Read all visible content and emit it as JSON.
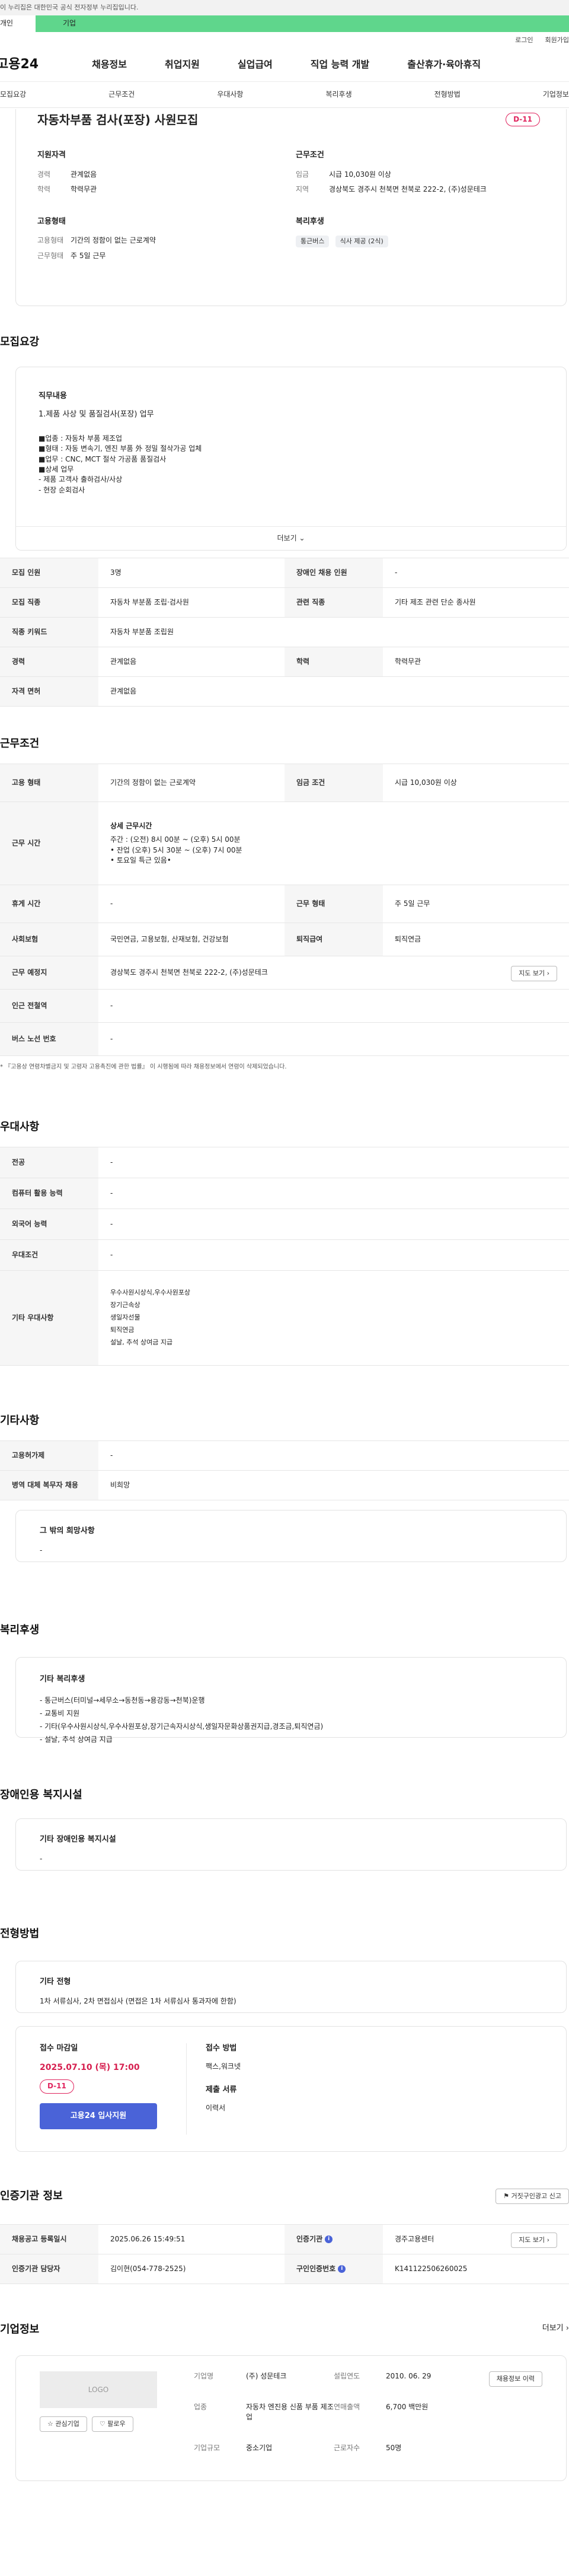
{
  "gov_banner": "이 누리집은 대한민국 공식 전자정부 누리집입니다.",
  "top_tabs": [
    "개인",
    "기업"
  ],
  "util_links": [
    "로그인",
    "회원가입"
  ],
  "logo": "고용24",
  "gnb": [
    "채용정보",
    "취업지원",
    "실업급여",
    "직업 능력 개발",
    "출산휴가·육아휴직"
  ],
  "anchor_tabs": [
    "모집요강",
    "근무조건",
    "우대사항",
    "복리후생",
    "전형방법",
    "기업정보"
  ],
  "job": {
    "title": "자동차부품 검사(포장) 사원모집",
    "dday": "D-11",
    "qualification_title": "지원자격",
    "career_label": "경력",
    "career_value": "관계없음",
    "edu_label": "학력",
    "edu_value": "학력무관",
    "worktype_title": "고용형태",
    "emp_label": "고용형태",
    "emp_value": "기간의 정함이 없는 근로계약",
    "days_label": "근무형태",
    "days_value": "주 5일 근무",
    "cond_title": "근무조건",
    "wage_label": "임금",
    "wage_value": "시급 10,030원 이상",
    "region_label": "지역",
    "region_value": "경상북도 경주시 천북면 천북로 222-2, (주)성문테크",
    "welfare_title": "복리후생",
    "welfare_tags": [
      "통근버스",
      "식사 제공 (2식)"
    ]
  },
  "recruit": {
    "section_title": "모집요강",
    "duty_title": "직무내용",
    "duty_main": "1.제품 사상 및 품질검사(포장) 업무",
    "duty_lines": [
      "■업종 : 자동차 부품 제조업",
      "■형태 : 자동 변속기, 엔진 부품 外 정밀 절삭가공 업체",
      "■업무 : CNC, MCT 절삭 가공품 품질검사",
      "■상세 업무",
      "  - 제품 고객사 출하검사/사상",
      "  - 현장 순회검사"
    ],
    "more_label": "더보기",
    "rows": [
      {
        "k1": "모집 인원",
        "v1": "3명",
        "k2": "장애인 채용 인원",
        "v2": "-"
      },
      {
        "k1": "모집 직종",
        "v1": "자동차 부분품 조립·검사원",
        "k2": "관련 직종",
        "v2": "기타 제조 관련 단순 종사원"
      },
      {
        "k1": "직종 키워드",
        "v1": "자동차 부분품 조립원"
      },
      {
        "k1": "경력",
        "v1": "관계없음",
        "k2": "학력",
        "v2": "학력무관"
      },
      {
        "k1": "자격 면허",
        "v1": "관계없음"
      }
    ]
  },
  "conditions": {
    "section_title": "근무조건",
    "emp_k": "고용 형태",
    "emp_v": "기간의 정함이 없는 근로계약",
    "wage_k": "임금 조건",
    "wage_v": "시급 10,030원 이상",
    "time_k": "근무 시간",
    "time_sub": "상세 근무시간",
    "time_lines": [
      "주간 : (오전) 8시 00분 ~ (오후) 5시 00분",
      "• 잔업 (오후) 5시 30분 ~ (오후) 7시 00분",
      "• 토요일 특근 있음•"
    ],
    "holiday_k": "휴게 시간",
    "holiday_v": "-",
    "form_k": "근무 형태",
    "form_v": "주 5일 근무",
    "insurance_k": "사회보험",
    "insurance_v": "국민연금, 고용보험, 산재보험, 건강보험",
    "retire_k": "퇴직급여",
    "retire_v": "퇴직연금",
    "place_k": "근무 예정지",
    "place_v": "경상북도 경주시 천북면 천북로 222-2, (주)성문테크",
    "map_label": "지도 보기",
    "subway_k": "인근 전철역",
    "subway_v": "-",
    "bus_k": "버스 노선 번호",
    "bus_v": "-",
    "note": "* 『고용상 연령차별금지 및 고령자 고용촉진에 관한 법률』 이 시행됨에 따라 채용정보에서 연령이 삭제되었습니다."
  },
  "preference": {
    "section_title": "우대사항",
    "rows": [
      {
        "k": "전공",
        "v": "-"
      },
      {
        "k": "컴퓨터 활용 능력",
        "v": "-"
      },
      {
        "k": "외국어 능력",
        "v": "-"
      },
      {
        "k": "우대조건",
        "v": "-"
      }
    ],
    "other_k": "기타 우대사항",
    "other_lines": [
      "우수사원시상식,우수사원포상",
      "장기근속상",
      "생일자선물",
      "퇴직연금",
      "설날, 추석 상여금 지급"
    ]
  },
  "etc": {
    "section_title": "기타사항",
    "rows": [
      {
        "k": "고용허가제",
        "v": "-"
      },
      {
        "k": "병역 대체 복무자 채용",
        "v": "비희망"
      }
    ],
    "hope_title": "그 밖의 희망사항",
    "hope_value": "-"
  },
  "welfare": {
    "section_title": "복리후생",
    "box_title": "기타 복리후생",
    "lines": [
      "- 통근버스(터미널→세무소→동천동→용강동→천북)운행",
      "- 교통비 지원",
      "- 기타(우수사원시상식,우수사원포상,장기근속자시상식,생일자문화상품권지급,경조금,퇴직연금)",
      "- 설날, 추석 상여금 지급"
    ]
  },
  "disabled": {
    "section_title": "장애인용 복지시설",
    "box_title": "기타 장애인용 복지시설",
    "value": "-"
  },
  "selection": {
    "section_title": "전형방법",
    "box_title": "기타 전형",
    "value": "1차 서류심사, 2차 면접심사 (면접은 1차 서류심사 통과자에 한함)",
    "deadline_title": "접수 마감일",
    "deadline": "2025.07.10 (목) 17:00",
    "dday": "D-11",
    "apply_btn": "고용24 입사지원",
    "method_title": "접수 방법",
    "method_value": "팩스,워크넷",
    "doc_title": "제출 서류",
    "doc_value": "이력서"
  },
  "agency": {
    "section_title": "인증기관 정보",
    "report_btn": "거짓구인광고 신고",
    "reg_k": "채용공고 등록일시",
    "reg_v": "2025.06.26 15:49:51",
    "org_k": "인증기관",
    "org_v": "경주고용센터",
    "map_label": "지도 보기",
    "manager_k": "인증기관 담당자",
    "manager_v": "김이현(054-778-2525)",
    "job_no_k": "구인인증번호",
    "job_no_v": "K141122506260025"
  },
  "company": {
    "section_title": "기업정보",
    "more_label": "더보기",
    "logo_text": "LOGO",
    "interest_btn": "관심기업",
    "follow_btn": "팔로우",
    "name_k": "기업명",
    "name_v": "(주) 성문테크",
    "founded_k": "설립연도",
    "founded_v": "2010. 06. 29",
    "industry_k": "업종",
    "industry_v": "자동차 엔진용 신품 부품 제조업",
    "sales_k": "연매출액",
    "sales_v": "6,700 백만원",
    "employees_k": "근로자수",
    "employees_v": "50명",
    "size_k": "기업규모",
    "size_v": "중소기업",
    "recruit_btn": "채용정보 이력"
  }
}
